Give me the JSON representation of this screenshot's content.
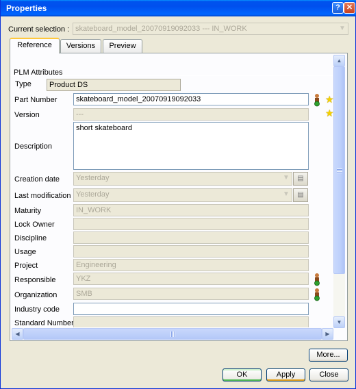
{
  "window": {
    "title": "Properties",
    "help_label": "?",
    "close_label": "✕"
  },
  "current_selection": {
    "label": "Current selection :",
    "value": "skateboard_model_20070919092033 --- IN_WORK"
  },
  "tabs": [
    {
      "label": "Reference",
      "active": true
    },
    {
      "label": "Versions",
      "active": false
    },
    {
      "label": "Preview",
      "active": false
    }
  ],
  "plm": {
    "group_label": "PLM Attributes",
    "type_label": "Type",
    "type_value": "Product DS",
    "part_number": {
      "label": "Part Number",
      "value": "skateboard_model_20070919092033"
    },
    "version": {
      "label": "Version",
      "value": "---"
    },
    "description": {
      "label": "Description",
      "value": "short skateboard"
    },
    "creation_date": {
      "label": "Creation date",
      "value": "Yesterday"
    },
    "last_modification": {
      "label": "Last modification",
      "value": "Yesterday"
    },
    "maturity": {
      "label": "Maturity",
      "value": "IN_WORK"
    },
    "lock_owner": {
      "label": "Lock Owner",
      "value": ""
    },
    "discipline": {
      "label": "Discipline",
      "value": ""
    },
    "usage": {
      "label": "Usage",
      "value": ""
    },
    "project": {
      "label": "Project",
      "value": "Engineering"
    },
    "responsible": {
      "label": "Responsible",
      "value": "YKZ"
    },
    "organization": {
      "label": "Organization",
      "value": "SMB"
    },
    "industry_code": {
      "label": "Industry code",
      "value": ""
    },
    "standard_number": {
      "label": "Standard Number",
      "value": ""
    }
  },
  "buttons": {
    "more": "More...",
    "ok": "OK",
    "apply": "Apply",
    "close": "Close"
  },
  "icons": {
    "user": "user-status-icon",
    "star": "star-icon",
    "calendar": "calendar-icon"
  },
  "colors": {
    "title_bar": "#0054e3",
    "ok_accent": "#55bd55",
    "apply_accent": "#e5a019",
    "star": "#f5d100"
  }
}
